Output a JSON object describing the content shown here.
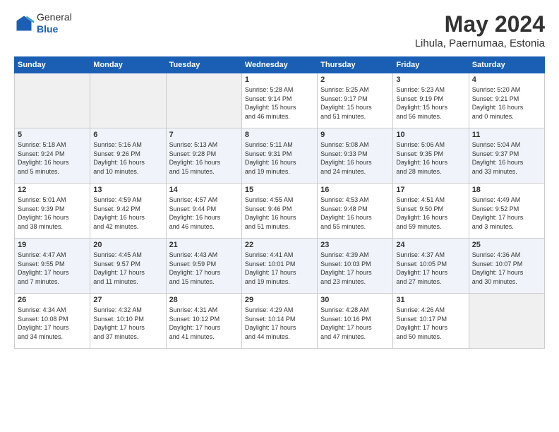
{
  "header": {
    "logo_line1": "General",
    "logo_line2": "Blue",
    "title": "May 2024",
    "subtitle": "Lihula, Paernumaa, Estonia"
  },
  "days_of_week": [
    "Sunday",
    "Monday",
    "Tuesday",
    "Wednesday",
    "Thursday",
    "Friday",
    "Saturday"
  ],
  "weeks": [
    [
      {
        "day": "",
        "info": ""
      },
      {
        "day": "",
        "info": ""
      },
      {
        "day": "",
        "info": ""
      },
      {
        "day": "1",
        "info": "Sunrise: 5:28 AM\nSunset: 9:14 PM\nDaylight: 15 hours\nand 46 minutes."
      },
      {
        "day": "2",
        "info": "Sunrise: 5:25 AM\nSunset: 9:17 PM\nDaylight: 15 hours\nand 51 minutes."
      },
      {
        "day": "3",
        "info": "Sunrise: 5:23 AM\nSunset: 9:19 PM\nDaylight: 15 hours\nand 56 minutes."
      },
      {
        "day": "4",
        "info": "Sunrise: 5:20 AM\nSunset: 9:21 PM\nDaylight: 16 hours\nand 0 minutes."
      }
    ],
    [
      {
        "day": "5",
        "info": "Sunrise: 5:18 AM\nSunset: 9:24 PM\nDaylight: 16 hours\nand 5 minutes."
      },
      {
        "day": "6",
        "info": "Sunrise: 5:16 AM\nSunset: 9:26 PM\nDaylight: 16 hours\nand 10 minutes."
      },
      {
        "day": "7",
        "info": "Sunrise: 5:13 AM\nSunset: 9:28 PM\nDaylight: 16 hours\nand 15 minutes."
      },
      {
        "day": "8",
        "info": "Sunrise: 5:11 AM\nSunset: 9:31 PM\nDaylight: 16 hours\nand 19 minutes."
      },
      {
        "day": "9",
        "info": "Sunrise: 5:08 AM\nSunset: 9:33 PM\nDaylight: 16 hours\nand 24 minutes."
      },
      {
        "day": "10",
        "info": "Sunrise: 5:06 AM\nSunset: 9:35 PM\nDaylight: 16 hours\nand 28 minutes."
      },
      {
        "day": "11",
        "info": "Sunrise: 5:04 AM\nSunset: 9:37 PM\nDaylight: 16 hours\nand 33 minutes."
      }
    ],
    [
      {
        "day": "12",
        "info": "Sunrise: 5:01 AM\nSunset: 9:39 PM\nDaylight: 16 hours\nand 38 minutes."
      },
      {
        "day": "13",
        "info": "Sunrise: 4:59 AM\nSunset: 9:42 PM\nDaylight: 16 hours\nand 42 minutes."
      },
      {
        "day": "14",
        "info": "Sunrise: 4:57 AM\nSunset: 9:44 PM\nDaylight: 16 hours\nand 46 minutes."
      },
      {
        "day": "15",
        "info": "Sunrise: 4:55 AM\nSunset: 9:46 PM\nDaylight: 16 hours\nand 51 minutes."
      },
      {
        "day": "16",
        "info": "Sunrise: 4:53 AM\nSunset: 9:48 PM\nDaylight: 16 hours\nand 55 minutes."
      },
      {
        "day": "17",
        "info": "Sunrise: 4:51 AM\nSunset: 9:50 PM\nDaylight: 16 hours\nand 59 minutes."
      },
      {
        "day": "18",
        "info": "Sunrise: 4:49 AM\nSunset: 9:52 PM\nDaylight: 17 hours\nand 3 minutes."
      }
    ],
    [
      {
        "day": "19",
        "info": "Sunrise: 4:47 AM\nSunset: 9:55 PM\nDaylight: 17 hours\nand 7 minutes."
      },
      {
        "day": "20",
        "info": "Sunrise: 4:45 AM\nSunset: 9:57 PM\nDaylight: 17 hours\nand 11 minutes."
      },
      {
        "day": "21",
        "info": "Sunrise: 4:43 AM\nSunset: 9:59 PM\nDaylight: 17 hours\nand 15 minutes."
      },
      {
        "day": "22",
        "info": "Sunrise: 4:41 AM\nSunset: 10:01 PM\nDaylight: 17 hours\nand 19 minutes."
      },
      {
        "day": "23",
        "info": "Sunrise: 4:39 AM\nSunset: 10:03 PM\nDaylight: 17 hours\nand 23 minutes."
      },
      {
        "day": "24",
        "info": "Sunrise: 4:37 AM\nSunset: 10:05 PM\nDaylight: 17 hours\nand 27 minutes."
      },
      {
        "day": "25",
        "info": "Sunrise: 4:36 AM\nSunset: 10:07 PM\nDaylight: 17 hours\nand 30 minutes."
      }
    ],
    [
      {
        "day": "26",
        "info": "Sunrise: 4:34 AM\nSunset: 10:08 PM\nDaylight: 17 hours\nand 34 minutes."
      },
      {
        "day": "27",
        "info": "Sunrise: 4:32 AM\nSunset: 10:10 PM\nDaylight: 17 hours\nand 37 minutes."
      },
      {
        "day": "28",
        "info": "Sunrise: 4:31 AM\nSunset: 10:12 PM\nDaylight: 17 hours\nand 41 minutes."
      },
      {
        "day": "29",
        "info": "Sunrise: 4:29 AM\nSunset: 10:14 PM\nDaylight: 17 hours\nand 44 minutes."
      },
      {
        "day": "30",
        "info": "Sunrise: 4:28 AM\nSunset: 10:16 PM\nDaylight: 17 hours\nand 47 minutes."
      },
      {
        "day": "31",
        "info": "Sunrise: 4:26 AM\nSunset: 10:17 PM\nDaylight: 17 hours\nand 50 minutes."
      },
      {
        "day": "",
        "info": ""
      }
    ]
  ]
}
